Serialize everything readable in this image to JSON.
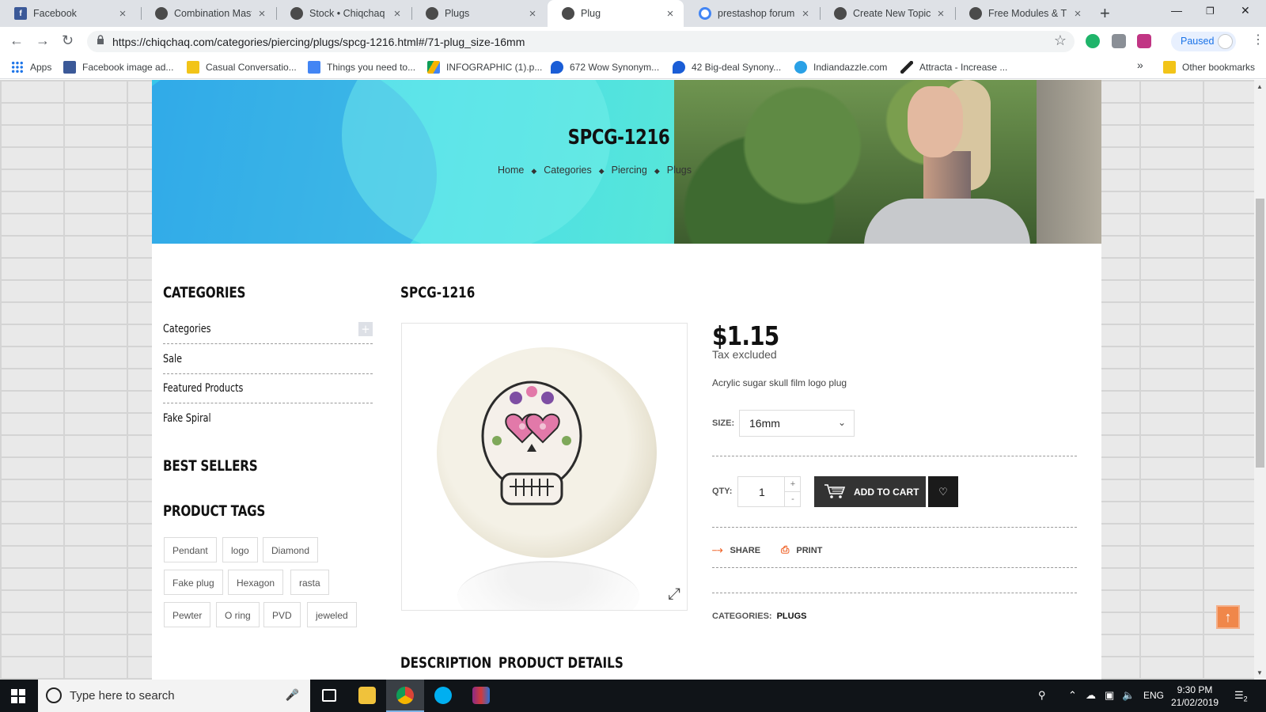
{
  "browser": {
    "tabs": [
      {
        "title": "Facebook",
        "icon": "facebook-icon",
        "color": "#3b5998"
      },
      {
        "title": "Combination Maste",
        "icon": "prestashop-icon",
        "color": "#4b4b4b"
      },
      {
        "title": "Stock • Chiqchaq Bo",
        "icon": "prestashop-icon",
        "color": "#4b4b4b"
      },
      {
        "title": "Plugs",
        "icon": "prestashop-icon",
        "color": "#4b4b4b"
      },
      {
        "title": "Plug",
        "icon": "prestashop-icon",
        "color": "#4b4b4b",
        "active": true
      },
      {
        "title": "prestashop forum -",
        "icon": "google-icon",
        "color": "#4285f4"
      },
      {
        "title": "Create New Topic -",
        "icon": "prestashop-icon",
        "color": "#4b4b4b"
      },
      {
        "title": "Free Modules & The",
        "icon": "prestashop-icon",
        "color": "#4b4b4b"
      }
    ],
    "close_glyph": "×",
    "new_tab_glyph": "+",
    "url": "https://chiqchaq.com/categories/piercing/plugs/spcg-1216.html#/71-plug_size-16mm",
    "profile_status": "Paused",
    "bookmarks": [
      {
        "label": "Apps",
        "icon": "apps-grid-icon",
        "color": "#1a73e8"
      },
      {
        "label": "Facebook image ad...",
        "icon": "facebook-icon",
        "color": "#3b5998"
      },
      {
        "label": "Casual Conversatio...",
        "icon": "folder-icon",
        "color": "#f2c418"
      },
      {
        "label": "Things you need to...",
        "icon": "docs-icon",
        "color": "#4285f4"
      },
      {
        "label": "INFOGRAPHIC (1).p...",
        "icon": "drive-icon",
        "color": "#0f9d58"
      },
      {
        "label": "672 Wow Synonym...",
        "icon": "thesaurus-icon",
        "color": "#1a5dd6"
      },
      {
        "label": "42 Big-deal Synony...",
        "icon": "thesaurus-icon",
        "color": "#1a5dd6"
      },
      {
        "label": "Indiandazzle.com",
        "icon": "globe-icon",
        "color": "#2aa1e6"
      },
      {
        "label": "Attracta - Increase ...",
        "icon": "attracta-icon",
        "color": "#222222"
      }
    ],
    "overflow_glyph": "»",
    "other_bookmarks": "Other bookmarks"
  },
  "hero": {
    "title": "SPCG-1216",
    "breadcrumbs": [
      "Home",
      "Categories",
      "Piercing",
      "Plugs"
    ],
    "breadcrumb_sep": "◆"
  },
  "sidebar": {
    "categories_heading": "CATEGORIES",
    "categories": [
      "Categories",
      "Sale",
      "Featured Products",
      "Fake Spiral"
    ],
    "best_sellers_heading": "BEST SELLERS",
    "tags_heading": "PRODUCT TAGS",
    "tags": [
      "Pendant",
      "logo",
      "Diamond",
      "Fake plug",
      "Hexagon",
      "rasta",
      "Pewter",
      "O ring",
      "PVD",
      "jeweled"
    ]
  },
  "product": {
    "title": "SPCG-1216",
    "price": "$1.15",
    "tax_note": "Tax excluded",
    "description": "Acrylic sugar skull film logo plug",
    "size_label": "SIZE:",
    "size_value": "16mm",
    "qty_label": "QTY:",
    "qty_value": "1",
    "qty_up": "+",
    "qty_down": "-",
    "add_to_cart": "ADD TO CART",
    "share": "SHARE",
    "print": "PRINT",
    "categories_label": "CATEGORIES:",
    "categories_value": "PLUGS",
    "tabs": [
      "DESCRIPTION",
      "PRODUCT DETAILS"
    ],
    "accent_color": "#f0672e"
  },
  "taskbar": {
    "search_placeholder": "Type here to search",
    "language": "ENG",
    "time": "9:30 PM",
    "date": "21/02/2019",
    "notification_count": "2"
  }
}
